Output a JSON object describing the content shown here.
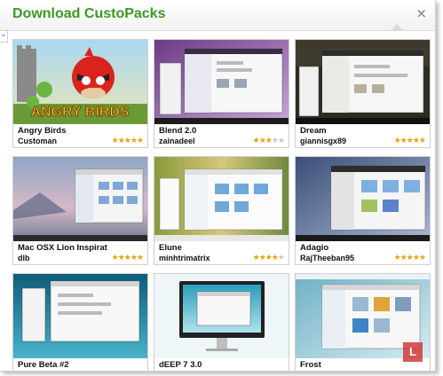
{
  "header": {
    "title": "Download CustoPacks",
    "close_glyph": "×"
  },
  "left_stub": "⌄",
  "packs": [
    {
      "name": "Angry Birds",
      "author": "Customan",
      "rating": 5,
      "thumb": "angry-birds"
    },
    {
      "name": "Blend 2.0",
      "author": "zainadeel",
      "rating": 3,
      "thumb": "purple-desktop"
    },
    {
      "name": "Dream",
      "author": "giannisgx89",
      "rating": 5,
      "thumb": "dark-desktop"
    },
    {
      "name": "Mac OSX Lion Inspirat",
      "author": "dlb",
      "rating": 5,
      "thumb": "lion-desktop"
    },
    {
      "name": "Elune",
      "author": "minhtrimatrix",
      "rating": 4,
      "thumb": "green-desktop"
    },
    {
      "name": "Adagio",
      "author": "RajTheeban95",
      "rating": 5,
      "thumb": "blue-desktop"
    },
    {
      "name": "Pure Beta #2",
      "author": "",
      "rating": 0,
      "thumb": "teal-desktop"
    },
    {
      "name": "dEEP 7 3.0",
      "author": "",
      "rating": 0,
      "thumb": "imac-desktop"
    },
    {
      "name": "Frost",
      "author": "",
      "rating": 0,
      "thumb": "frost-desktop"
    }
  ],
  "colors": {
    "title": "#3d9a24",
    "star_on": "#e0a51b",
    "star_off": "#c9c9c9"
  },
  "watermark": "L"
}
